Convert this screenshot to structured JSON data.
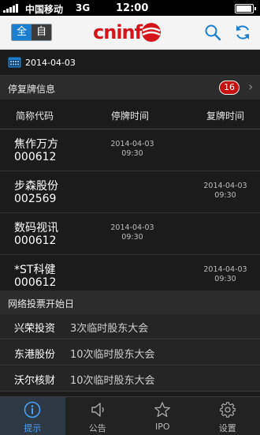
{
  "status": {
    "carrier": "中国移动",
    "network": "3G",
    "time": "12:00"
  },
  "header": {
    "toggle_left": "全",
    "toggle_right": "自",
    "logo": "cninf"
  },
  "date": "2014-04-03",
  "suspension": {
    "title": "停复牌信息",
    "count": "16",
    "columns": {
      "name": "简称代码",
      "suspend": "停牌时间",
      "resume": "复牌时间"
    },
    "rows": [
      {
        "name": "焦作万方",
        "code": "000612",
        "suspend_date": "2014-04-03",
        "suspend_time": "09:30",
        "resume_date": "",
        "resume_time": ""
      },
      {
        "name": "步森股份",
        "code": "002569",
        "suspend_date": "",
        "suspend_time": "",
        "resume_date": "2014-04-03",
        "resume_time": "09:30"
      },
      {
        "name": "数码视讯",
        "code": "000612",
        "suspend_date": "2014-04-03",
        "suspend_time": "09:30",
        "resume_date": "",
        "resume_time": ""
      },
      {
        "name": "*ST科健",
        "code": "000612",
        "suspend_date": "",
        "suspend_time": "",
        "resume_date": "2014-04-03",
        "resume_time": "09:30"
      }
    ]
  },
  "voting": {
    "title": "网络投票开始日",
    "rows": [
      {
        "name": "兴荣投资",
        "meeting": "3次临时股东大会"
      },
      {
        "name": "东港股份",
        "meeting": "10次临时股东大会"
      },
      {
        "name": "沃尔核财",
        "meeting": "10次临时股东大会"
      }
    ]
  },
  "tabs": [
    {
      "label": "提示",
      "icon": "info-icon"
    },
    {
      "label": "公告",
      "icon": "speaker-icon"
    },
    {
      "label": "IPO",
      "icon": "star-icon"
    },
    {
      "label": "设置",
      "icon": "gear-icon"
    }
  ],
  "colors": {
    "accent": "#1a7fd0",
    "brand": "#d4161c",
    "badge": "#c61010",
    "active_tab": "#4aa3ff"
  }
}
